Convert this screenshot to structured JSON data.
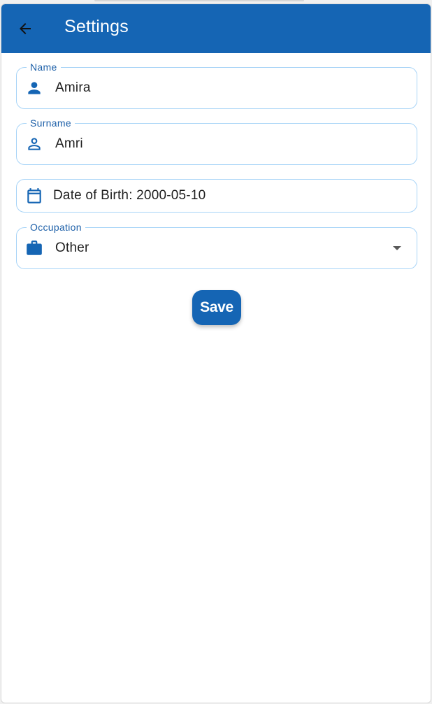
{
  "app_bar": {
    "title": "Settings",
    "back_icon": "arrow-back-icon"
  },
  "form": {
    "name": {
      "label": "Name",
      "value": "Amira",
      "icon": "person-icon"
    },
    "surname": {
      "label": "Surname",
      "value": "Amri",
      "icon": "person-outline-icon"
    },
    "date_of_birth": {
      "text": "Date of Birth: 2000-05-10",
      "icon": "calendar-icon"
    },
    "occupation": {
      "label": "Occupation",
      "selected": "Other",
      "icon": "briefcase-icon"
    }
  },
  "save_button": {
    "label": "Save"
  },
  "colors": {
    "primary": "#1565b4",
    "field_border": "#a8d4f7",
    "label": "#1c5fa8"
  }
}
